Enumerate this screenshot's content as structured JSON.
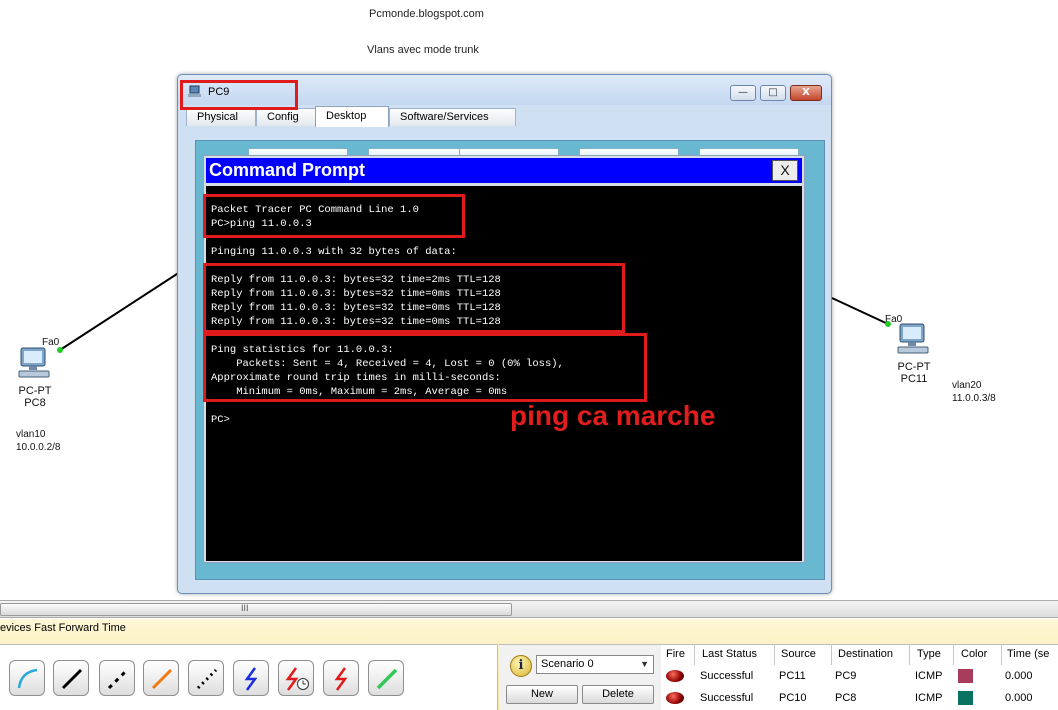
{
  "workspace": {
    "blog_note": "Pcmonde.blogspot.com",
    "topic_note": "Vlans avec mode trunk"
  },
  "devices": {
    "pc8": {
      "type": "PC-PT",
      "name": "PC8",
      "port": "Fa0",
      "vlan": "vlan10",
      "ip": "10.0.0.2/8"
    },
    "pc11": {
      "type": "PC-PT",
      "name": "PC11",
      "port": "Fa0",
      "vlan": "vlan20",
      "ip": "11.0.0.3/8"
    }
  },
  "window": {
    "title": "PC9",
    "minimize": "—",
    "restore": "□",
    "close": "X",
    "tabs": [
      {
        "label": "Physical"
      },
      {
        "label": "Config"
      },
      {
        "label": "Desktop"
      },
      {
        "label": "Software/Services"
      }
    ]
  },
  "command_prompt": {
    "title": "Command Prompt",
    "close_label": "X",
    "lines": [
      "Packet Tracer PC Command Line 1.0",
      "PC>ping 11.0.0.3",
      "Pinging 11.0.0.3 with 32 bytes of data:",
      "Reply from 11.0.0.3: bytes=32 time=2ms TTL=128",
      "Reply from 11.0.0.3: bytes=32 time=0ms TTL=128",
      "Reply from 11.0.0.3: bytes=32 time=0ms TTL=128",
      "Reply from 11.0.0.3: bytes=32 time=0ms TTL=128",
      "Ping statistics for 11.0.0.3:",
      "    Packets: Sent = 4, Received = 4, Lost = 0 (0% loss),",
      "Approximate round trip times in milli-seconds:",
      "    Minimum = 0ms, Maximum = 2ms, Average = 0ms",
      "PC>"
    ]
  },
  "annotation": "ping ca marche",
  "bottom": {
    "scroll_grip": "III",
    "device_bar": "evices  Fast Forward Time",
    "scenario": "Scenario 0",
    "new_label": "New",
    "delete_label": "Delete"
  },
  "pdu_table": {
    "headers": [
      "Fire",
      "Last Status",
      "Source",
      "Destination",
      "Type",
      "Color",
      "Time (se"
    ],
    "rows": [
      {
        "last_status": "Successful",
        "source": "PC11",
        "destination": "PC9",
        "type": "ICMP",
        "color": "#a83c5c",
        "time": "0.000"
      },
      {
        "last_status": "Successful",
        "source": "PC10",
        "destination": "PC8",
        "type": "ICMP",
        "color": "#0a7260",
        "time": "0.000"
      }
    ]
  },
  "colors": {
    "highlight": "#e01b1b",
    "cmd_header": "#0000ff",
    "terminal_bg": "#000000",
    "link_up": "#22cc22"
  }
}
